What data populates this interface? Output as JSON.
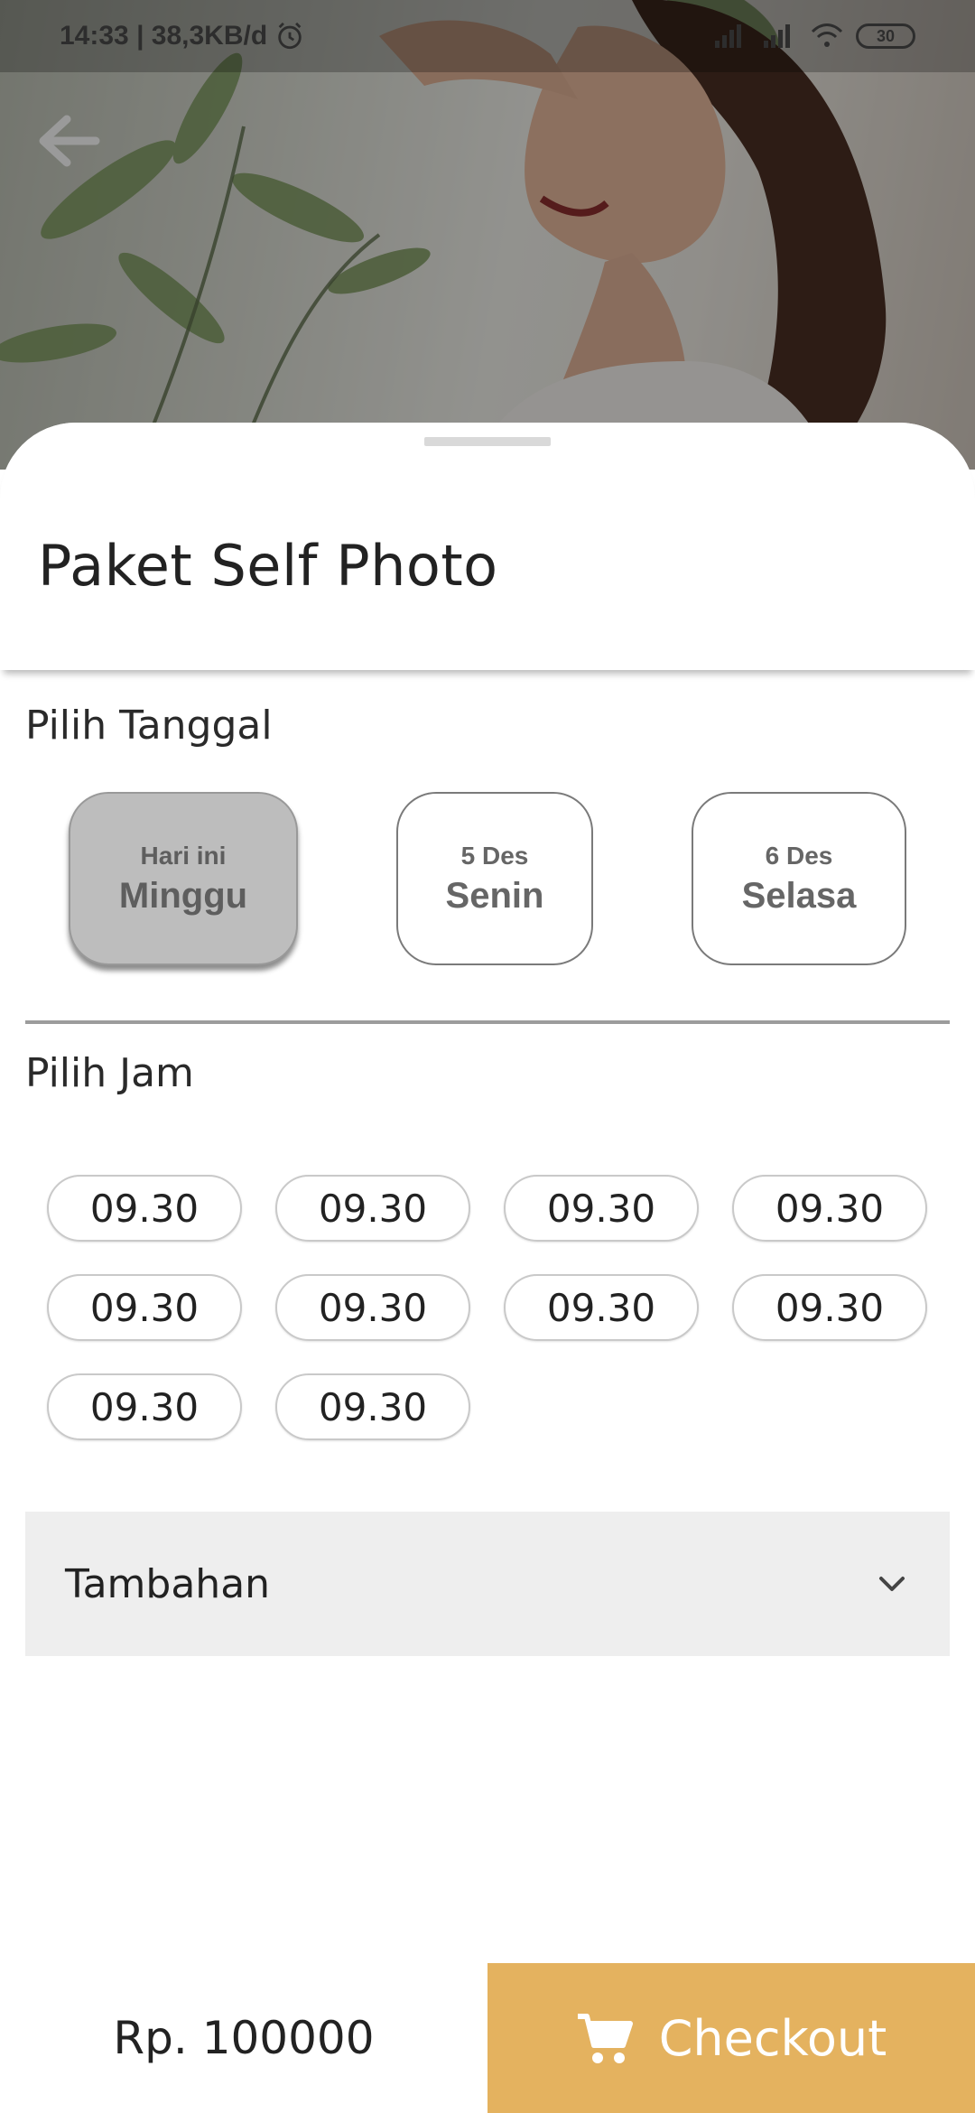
{
  "status_bar": {
    "time_info": "14:33 | 38,3KB/d",
    "battery": "30"
  },
  "icons": {
    "back": "arrow-left",
    "alarm": "alarm-clock",
    "signal": "cell-signal",
    "wifi": "wifi",
    "expand": "chevron-down",
    "cart": "shopping-cart"
  },
  "sheet": {
    "title": "Paket Self Photo"
  },
  "date_section": {
    "label": "Pilih Tanggal",
    "dates": [
      {
        "small": "Hari ini",
        "day": "Minggu",
        "selected": true
      },
      {
        "small": "5 Des",
        "day": "Senin",
        "selected": false
      },
      {
        "small": "6 Des",
        "day": "Selasa",
        "selected": false
      }
    ]
  },
  "time_section": {
    "label": "Pilih Jam",
    "times": [
      "09.30",
      "09.30",
      "09.30",
      "09.30",
      "09.30",
      "09.30",
      "09.30",
      "09.30",
      "09.30",
      "09.30"
    ]
  },
  "extras": {
    "label": "Tambahan"
  },
  "footer": {
    "price": "Rp. 100000",
    "checkout_label": "Checkout"
  },
  "colors": {
    "checkout_bg": "#e4b25f",
    "selected_date_bg": "#bdbdbd",
    "accordion_bg": "#eeeeee"
  }
}
